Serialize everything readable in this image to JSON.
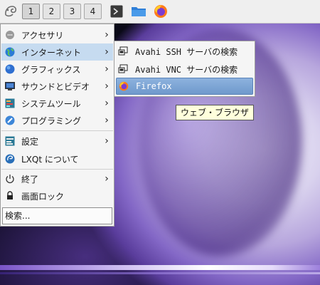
{
  "taskbar": {
    "desktops": [
      "1",
      "2",
      "3",
      "4"
    ],
    "active_desktop": "1",
    "icons": [
      "lxqt-logo-icon",
      "terminal-icon",
      "folder-icon",
      "firefox-icon"
    ]
  },
  "menu": {
    "items": [
      {
        "label": "アクセサリ",
        "icon": "accessories-icon"
      },
      {
        "label": "インターネット",
        "icon": "internet-globe-icon"
      },
      {
        "label": "グラフィックス",
        "icon": "graphics-icon"
      },
      {
        "label": "サウンドとビデオ",
        "icon": "multimedia-icon"
      },
      {
        "label": "システムツール",
        "icon": "system-tools-icon"
      },
      {
        "label": "プログラミング",
        "icon": "programming-icon"
      },
      {
        "label": "設定",
        "icon": "settings-icon"
      },
      {
        "label": "LXQt について",
        "icon": "about-icon"
      },
      {
        "label": "終了",
        "icon": "power-icon"
      },
      {
        "label": "画面ロック",
        "icon": "lock-icon"
      }
    ],
    "search_placeholder": "検索..."
  },
  "submenu": {
    "items": [
      {
        "label": "Avahi SSH サーバの検索",
        "icon": "network-icon"
      },
      {
        "label": "Avahi VNC サーバの検索",
        "icon": "network-icon"
      },
      {
        "label": "Firefox",
        "icon": "firefox-icon"
      }
    ]
  },
  "tooltip": "ウェブ・ブラウザ",
  "colors": {
    "highlight": "#c6dbf0",
    "submenu_highlight": "#7aa3d6",
    "tooltip_bg": "#ffffdc"
  }
}
